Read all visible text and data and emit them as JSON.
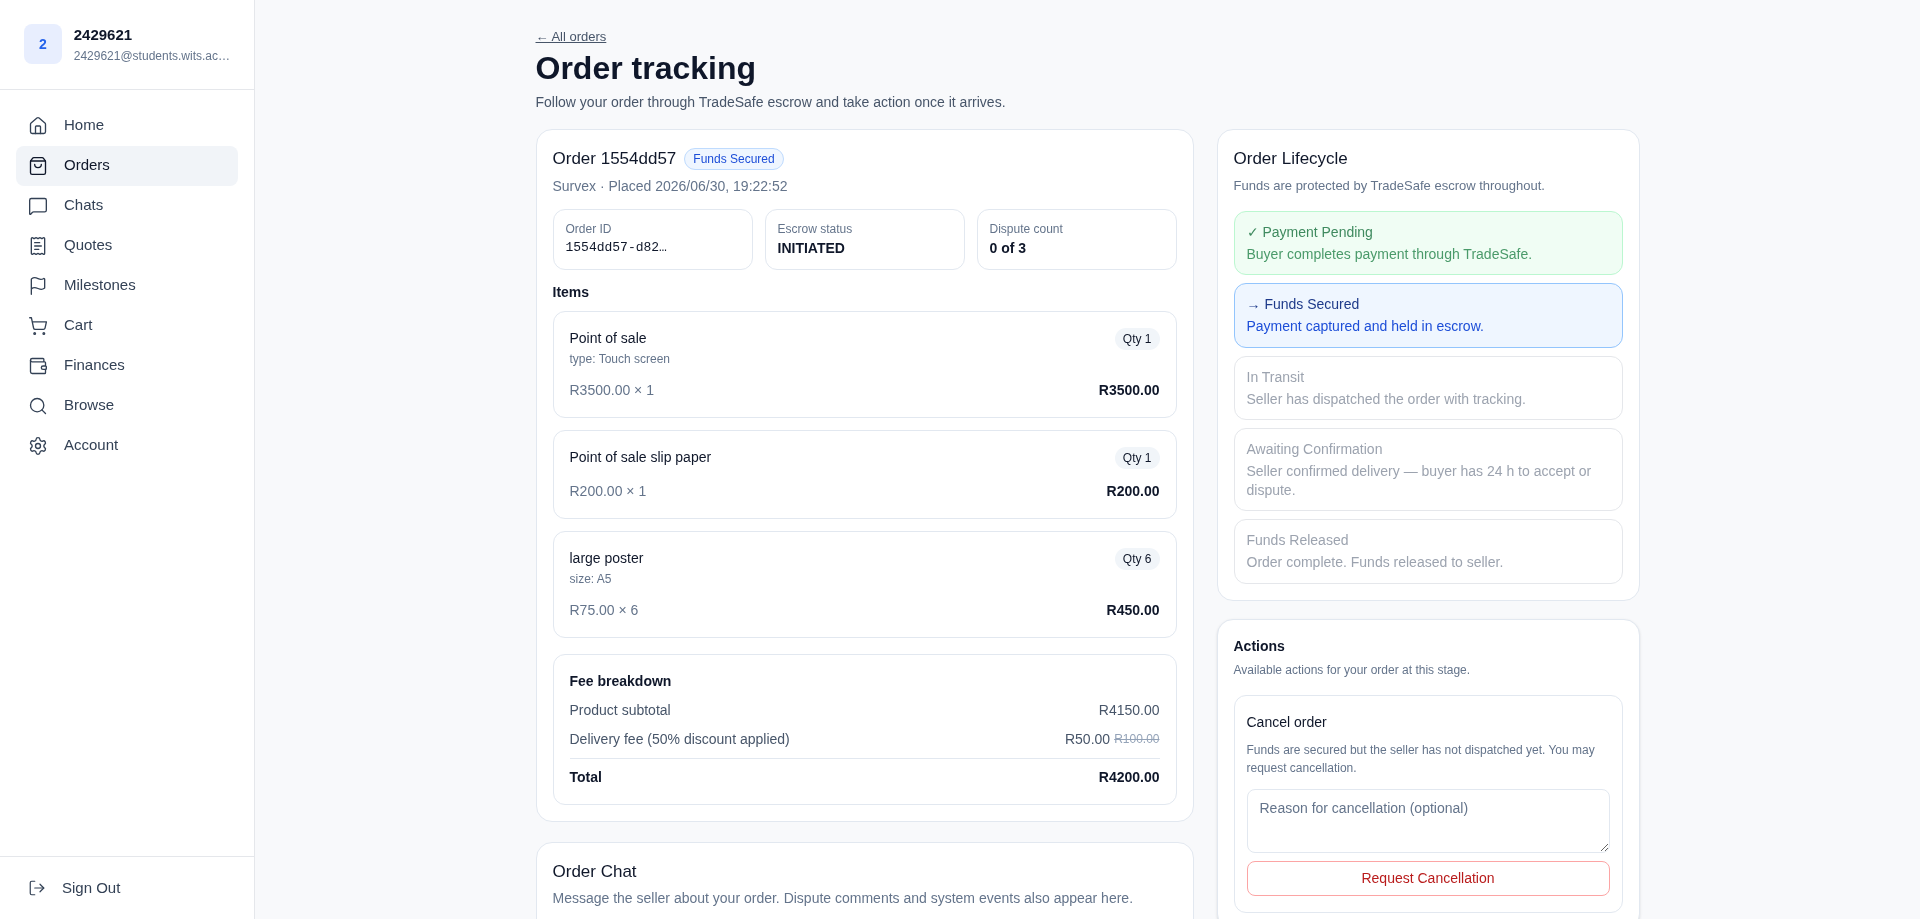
{
  "user": {
    "avatar_initial": "2",
    "name": "2429621",
    "email": "2429621@students.wits.ac…"
  },
  "nav": [
    {
      "label": "Home",
      "selected": false
    },
    {
      "label": "Orders",
      "selected": true
    },
    {
      "label": "Chats",
      "selected": false
    },
    {
      "label": "Quotes",
      "selected": false
    },
    {
      "label": "Milestones",
      "selected": false
    },
    {
      "label": "Cart",
      "selected": false
    },
    {
      "label": "Finances",
      "selected": false
    },
    {
      "label": "Browse",
      "selected": false
    },
    {
      "label": "Account",
      "selected": false
    }
  ],
  "sign_out": "Sign Out",
  "back_link": "← All orders",
  "title": "Order tracking",
  "subtitle": "Follow your order through TradeSafe escrow and take action once it arrives.",
  "order": {
    "title": "Order 1554dd57",
    "badge": "Funds Secured",
    "meta": "Survex · Placed 2026/06/30, 19:22:52",
    "stats": [
      {
        "label": "Order ID",
        "value": "1554dd57-d82…",
        "kind": "mono"
      },
      {
        "label": "Escrow status",
        "value": "INITIATED",
        "kind": "text"
      },
      {
        "label": "Dispute count",
        "value": "0 of 3",
        "kind": "text"
      }
    ],
    "items_heading": "Items",
    "items": [
      {
        "name": "Point of sale",
        "option": "type: Touch screen",
        "qty": "Qty 1",
        "unit": "R3500.00 × 1",
        "total": "R3500.00"
      },
      {
        "name": "Point of sale slip paper",
        "qty": "Qty 1",
        "unit": "R200.00 × 1",
        "total": "R200.00"
      },
      {
        "name": "large poster",
        "option": "size: A5",
        "qty": "Qty 6",
        "unit": "R75.00 × 6",
        "total": "R450.00"
      }
    ],
    "fees": {
      "heading": "Fee breakdown",
      "rows": [
        {
          "label": "Product subtotal",
          "value": "R4150.00"
        },
        {
          "label": "Delivery fee (50% discount applied)",
          "value": "R50.00",
          "old_value": "R100.00"
        }
      ],
      "total_label": "Total",
      "total_value": "R4200.00"
    }
  },
  "chat": {
    "title": "Order Chat",
    "description": "Message the seller about your order. Dispute comments and system events also appear here."
  },
  "lifecycle": {
    "title": "Order Lifecycle",
    "description": "Funds are protected by TradeSafe escrow throughout.",
    "stages": [
      {
        "title": "✓ Payment Pending",
        "description": "Buyer completes payment through TradeSafe.",
        "kind": "done"
      },
      {
        "title": "→ Funds Secured",
        "description": "Payment captured and held in escrow.",
        "kind": "current"
      },
      {
        "title": "In Transit",
        "description": "Seller has dispatched the order with tracking.",
        "kind": "upcoming"
      },
      {
        "title": "Awaiting Confirmation",
        "description": "Seller confirmed delivery — buyer has 24 h to accept or dispute.",
        "kind": "upcoming"
      },
      {
        "title": "Funds Released",
        "description": "Order complete. Funds released to seller.",
        "kind": "upcoming"
      }
    ]
  },
  "actions": {
    "title": "Actions",
    "description": "Available actions for your order at this stage.",
    "cancel": {
      "title": "Cancel order",
      "description": "Funds are secured but the seller has not dispatched yet. You may request cancellation.",
      "placeholder": "Reason for cancellation (optional)",
      "button": "Request Cancellation"
    }
  }
}
